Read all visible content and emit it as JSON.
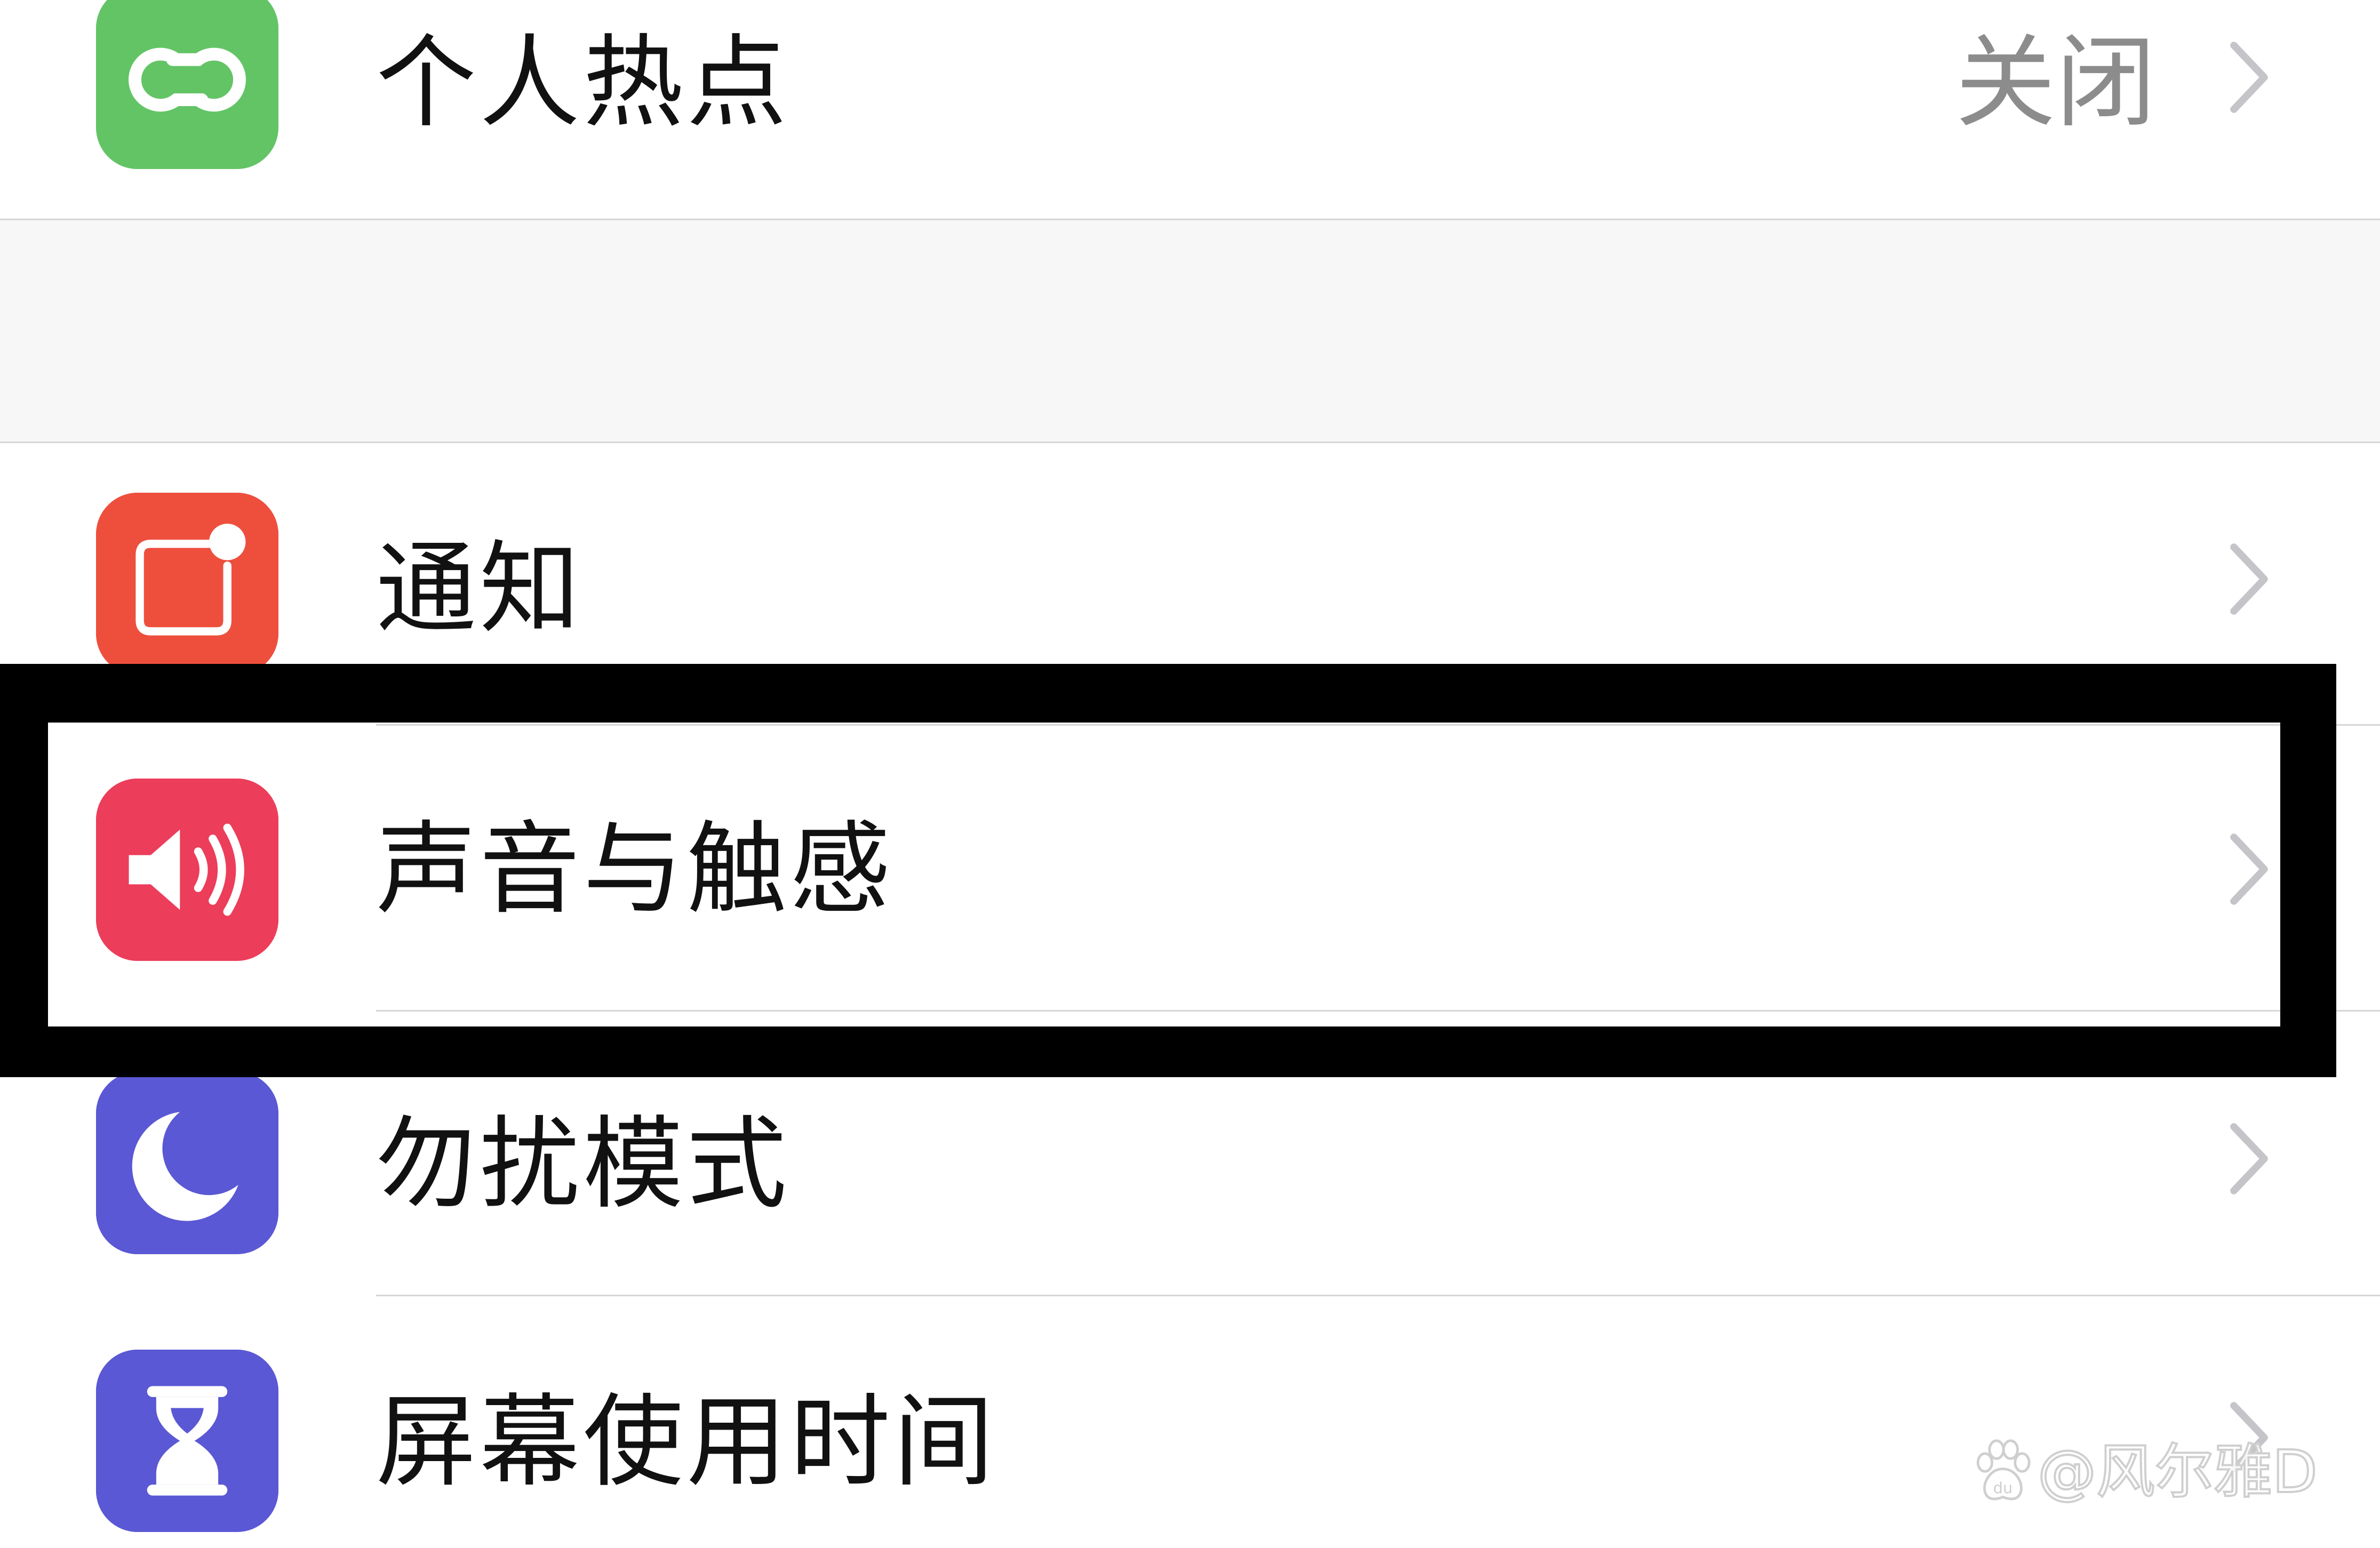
{
  "settings": {
    "rows": [
      {
        "label": "个人热点",
        "value": "关闭",
        "icon": "hotspot-icon",
        "icon_color": "#63c466"
      },
      {
        "label": "通知",
        "icon": "notifications-icon",
        "icon_color": "#ee4f3d"
      },
      {
        "label": "声音与触感",
        "icon": "sound-icon",
        "icon_color": "#ec3d5a"
      },
      {
        "label": "勿扰模式",
        "icon": "moon-icon",
        "icon_color": "#5a58d4"
      },
      {
        "label": "屏幕使用时间",
        "icon": "hourglass-icon",
        "icon_color": "#5a58d4"
      }
    ]
  },
  "highlight": {
    "target_row": "声音与触感",
    "border_color": "#000000"
  },
  "watermark": {
    "text": "@风尔雅D",
    "icon": "baidu-paw-icon"
  },
  "colors": {
    "chevron": "#c4c4c9",
    "separator": "#d6d6d6",
    "group_gap": "#f7f7f7"
  }
}
